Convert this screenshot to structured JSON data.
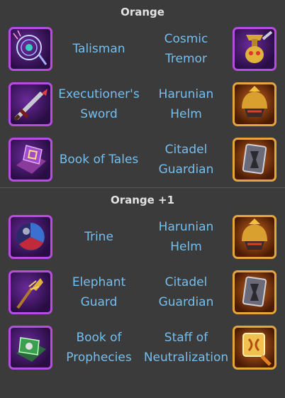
{
  "sections": [
    {
      "title": "Orange",
      "rows": [
        {
          "left": {
            "name": "Talisman",
            "icon": "talisman-icon"
          },
          "right": {
            "name": "Cosmic\nTremor",
            "icon": "cosmic-tremor-icon"
          }
        },
        {
          "left": {
            "name": "Executioner's\nSword",
            "icon": "executioners-sword-icon"
          },
          "right": {
            "name": "Harunian\nHelm",
            "icon": "harunian-helm-icon"
          }
        },
        {
          "left": {
            "name": "Book of Tales",
            "icon": "book-of-tales-icon"
          },
          "right": {
            "name": "Citadel\nGuardian",
            "icon": "citadel-guardian-icon"
          }
        }
      ]
    },
    {
      "title": "Orange +1",
      "rows": [
        {
          "left": {
            "name": "Trine",
            "icon": "trine-icon"
          },
          "right": {
            "name": "Harunian\nHelm",
            "icon": "harunian-helm-icon"
          }
        },
        {
          "left": {
            "name": "Elephant\nGuard",
            "icon": "elephant-guard-icon"
          },
          "right": {
            "name": "Citadel\nGuardian",
            "icon": "citadel-guardian-icon"
          }
        },
        {
          "left": {
            "name": "Book of\nProphecies",
            "icon": "book-of-prophecies-icon"
          },
          "right": {
            "name": "Staff of\nNeutralization",
            "icon": "staff-of-neutralization-icon"
          }
        }
      ]
    }
  ],
  "colors": {
    "background": "#3b3b3b",
    "title": "#e2e2e2",
    "item_name": "#74bff0",
    "purple_border": "#b54ee0",
    "gold_border": "#e4a53a"
  }
}
